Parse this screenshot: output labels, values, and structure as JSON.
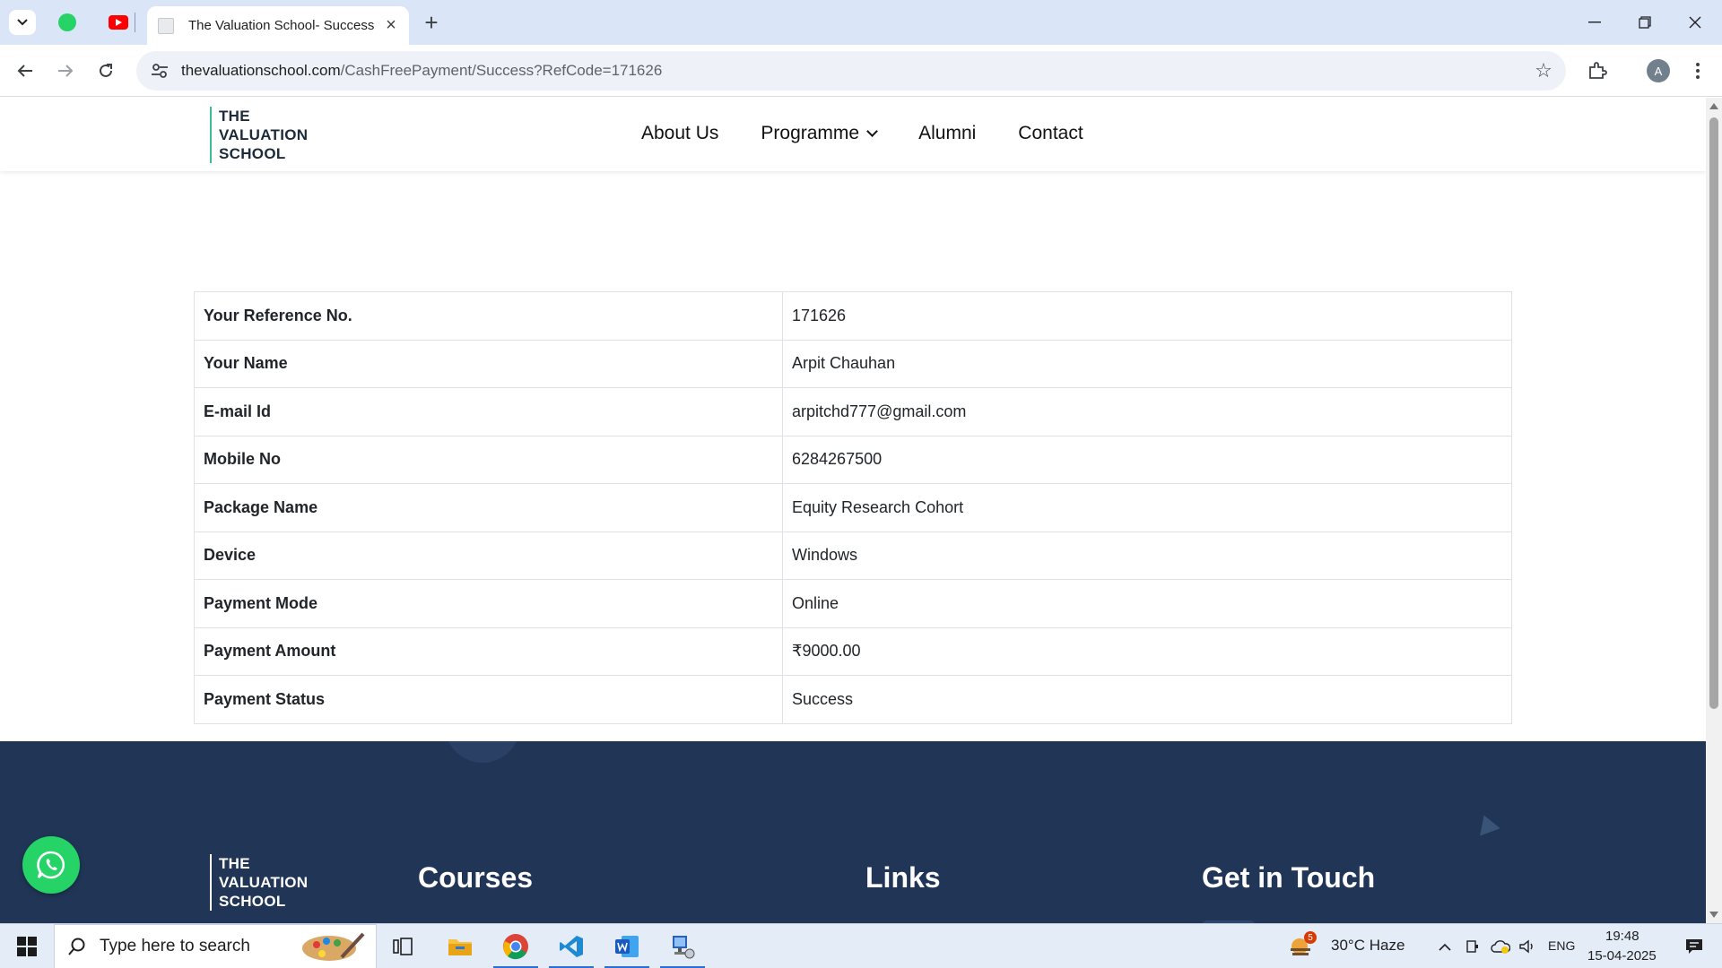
{
  "browser": {
    "tab_title": "The Valuation School- Success",
    "url_host": "thevaluationschool.com",
    "url_path": "/CashFreePayment/Success?RefCode=171626",
    "profile_initial": "A"
  },
  "site": {
    "logo_lines": [
      "THE",
      "VALUATION",
      "SCHOOL"
    ],
    "nav": [
      "About Us",
      "Programme",
      "Alumni",
      "Contact"
    ]
  },
  "details": [
    {
      "label": "Your Reference No.",
      "value": "171626"
    },
    {
      "label": "Your Name",
      "value": "Arpit Chauhan"
    },
    {
      "label": "E-mail Id",
      "value": "arpitchd777@gmail.com"
    },
    {
      "label": "Mobile No",
      "value": "6284267500"
    },
    {
      "label": "Package Name",
      "value": "Equity Research Cohort"
    },
    {
      "label": "Device",
      "value": "Windows"
    },
    {
      "label": "Payment Mode",
      "value": "Online"
    },
    {
      "label": "Payment Amount",
      "value": "₹9000.00"
    },
    {
      "label": "Payment Status",
      "value": "Success"
    }
  ],
  "footer": {
    "headings": [
      "Courses",
      "Links",
      "Get in Touch"
    ]
  },
  "taskbar": {
    "search_placeholder": "Type here to search",
    "weather_badge": "5",
    "weather": "30°C  Haze",
    "language": "ENG",
    "time": "19:48",
    "date": "15-04-2025"
  },
  "colors": {
    "footer_bg": "#213657",
    "whatsapp": "#25d366",
    "logo_accent": "#3bbf8f"
  }
}
